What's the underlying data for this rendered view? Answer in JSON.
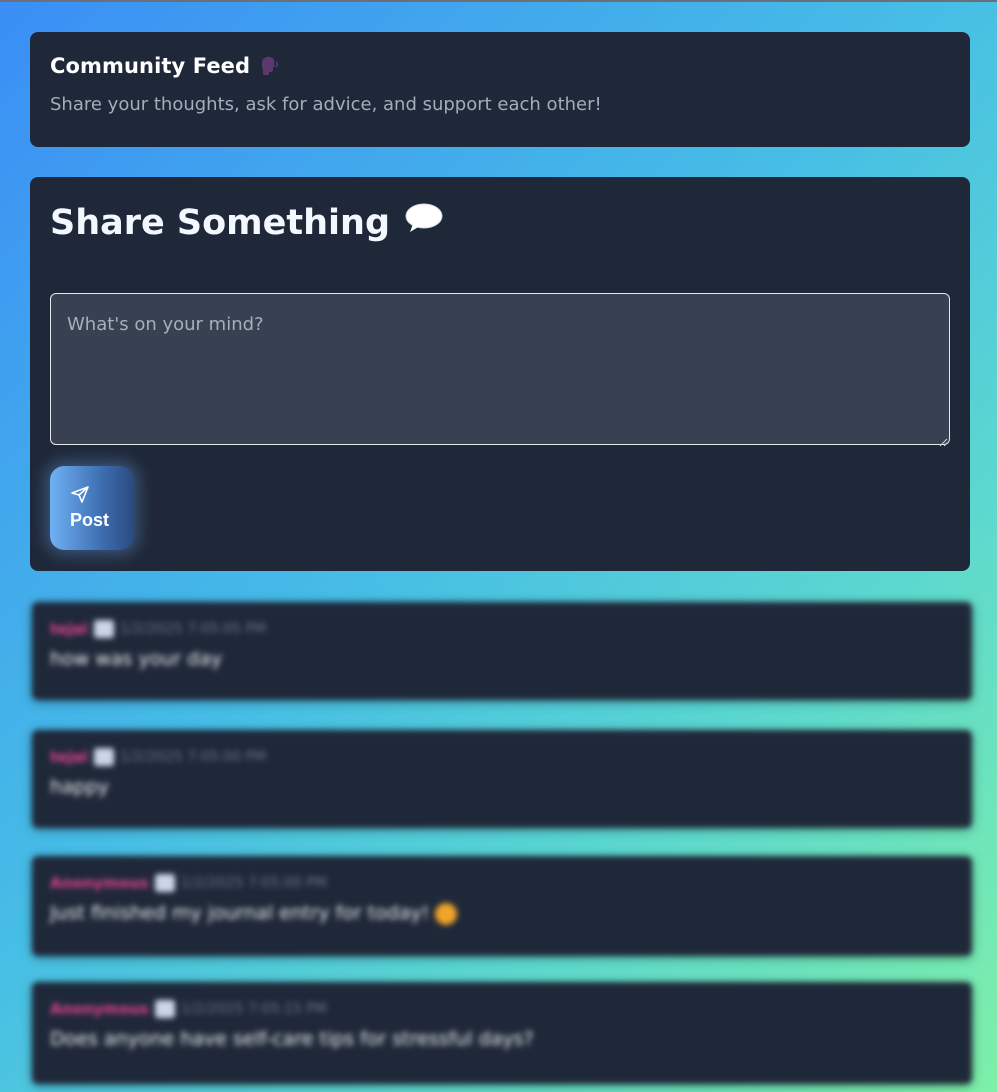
{
  "header": {
    "title": "Community Feed",
    "subtitle": "Share your thoughts, ask for advice, and support each other!",
    "icon": "speaking-head-icon"
  },
  "composer": {
    "title": "Share Something",
    "title_icon": "speech-bubble-icon",
    "placeholder": "What's on your mind?",
    "value": "",
    "post_label": "Post",
    "post_icon": "send-icon"
  },
  "feed": [
    {
      "author": "tejal",
      "badge_icon": "calendar-icon",
      "time": "1/2/2025 7:05:05 PM",
      "text": "how was your day",
      "emoji": ""
    },
    {
      "author": "tejal",
      "badge_icon": "calendar-icon",
      "time": "1/2/2025 7:05:00 PM",
      "text": "happy",
      "emoji": ""
    },
    {
      "author": "Anonymous",
      "badge_icon": "calendar-icon",
      "time": "1/2/2025 7:05:00 PM",
      "text": "Just finished my journal entry for today!",
      "emoji": "smiley-emoji"
    },
    {
      "author": "Anonymous",
      "badge_icon": "calendar-icon",
      "time": "1/2/2025 7:05:15 PM",
      "text": "Does anyone have self-care tips for stressful days?",
      "emoji": ""
    }
  ],
  "colors": {
    "card_bg": "#1f2839",
    "author": "#e0448f",
    "accent_start": "#6fb2f4",
    "accent_end": "#2a4a80"
  }
}
